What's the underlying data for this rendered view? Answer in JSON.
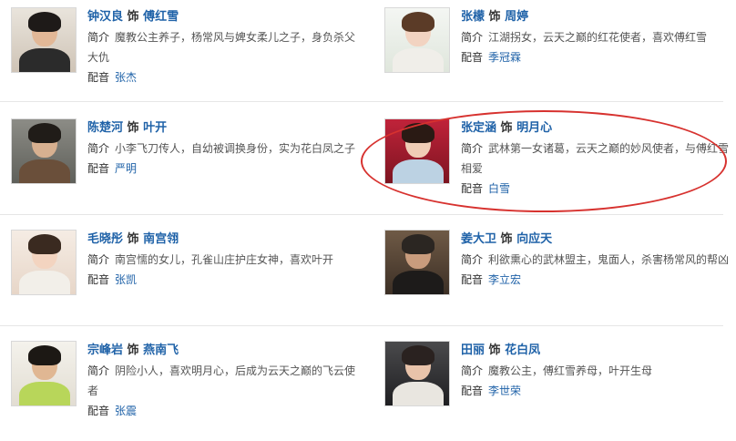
{
  "labels": {
    "shi": "饰",
    "intro": "简介",
    "dub": "配音"
  },
  "cards": [
    {
      "actor": "钟汉良",
      "role": "傅红雪",
      "intro": "魔教公主养子，杨常风与婢女柔儿之子，身负杀父大仇",
      "voice": "张杰"
    },
    {
      "actor": "张檬",
      "role": "周婷",
      "intro": "江湖拐女，云天之巅的红花使者，喜欢傅红雪",
      "voice": "季冠霖"
    },
    {
      "actor": "陈楚河",
      "role": "叶开",
      "intro": "小李飞刀传人，自幼被调换身份，实为花白凤之子",
      "voice": "严明"
    },
    {
      "actor": "张定涵",
      "role": "明月心",
      "intro": "武林第一女诸葛，云天之巅的妙风使者，与傅红雪相爱",
      "voice": "白雪"
    },
    {
      "actor": "毛晓彤",
      "role": "南宫翎",
      "intro": "南宫懦的女儿，孔雀山庄护庄女神，喜欢叶开",
      "voice": "张凯"
    },
    {
      "actor": "姜大卫",
      "role": "向应天",
      "intro": "利欲熏心的武林盟主，鬼面人，杀害杨常风的帮凶",
      "voice": "李立宏"
    },
    {
      "actor": "宗峰岩",
      "role": "燕南飞",
      "intro": "阴险小人，喜欢明月心，后成为云天之巅的飞云使者",
      "voice": "张震"
    },
    {
      "actor": "田丽",
      "role": "花白凤",
      "intro": "魔教公主，傅红雪养母，叶开生母",
      "voice": "李世荣"
    }
  ]
}
